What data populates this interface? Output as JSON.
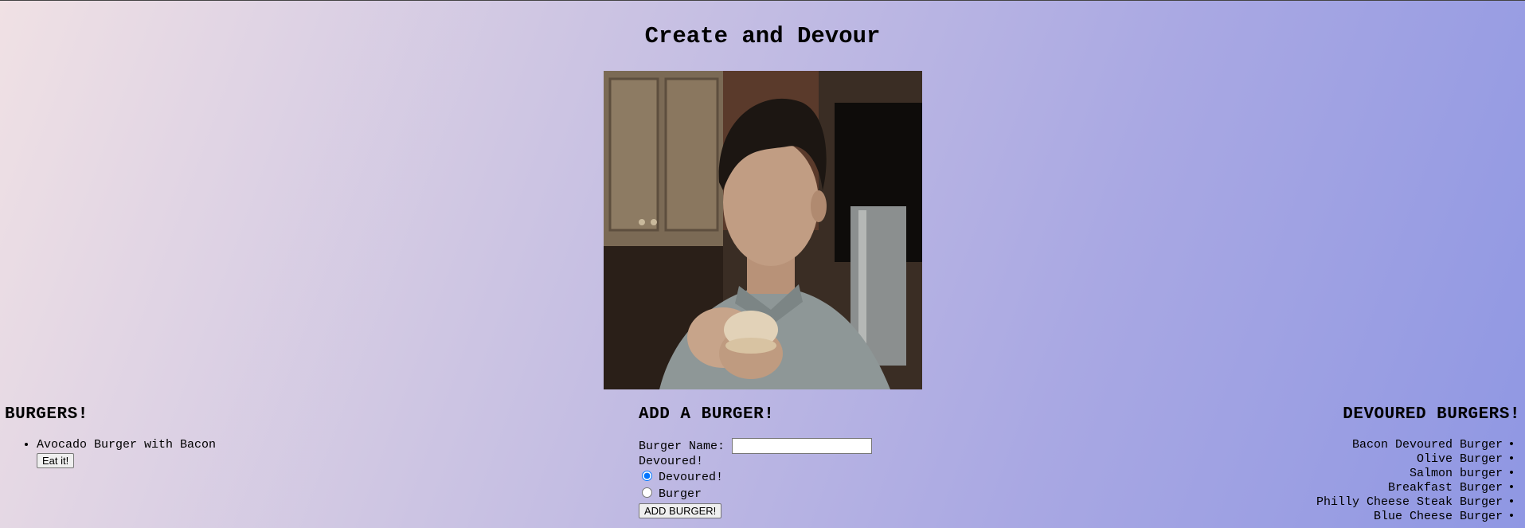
{
  "page": {
    "title": "Create and Devour"
  },
  "burgers": {
    "heading": "BURGERS!",
    "items": [
      {
        "name": "Avocado Burger with Bacon",
        "button_label": "Eat it!"
      }
    ]
  },
  "add_burger": {
    "heading": "ADD A BURGER!",
    "name_label": "Burger Name:",
    "name_value": "",
    "devoured_label": "Devoured!",
    "radio_options": [
      "Devoured!",
      "Burger"
    ],
    "selected_option": "Devoured!",
    "submit_label": "ADD BURGER!"
  },
  "devoured_burgers": {
    "heading": "DEVOURED BURGERS!",
    "items": [
      "Bacon Devoured Burger",
      "Olive Burger",
      "Salmon burger",
      "Breakfast Burger",
      "Philly Cheese Steak Burger",
      "Blue Cheese Burger"
    ]
  },
  "colors": {
    "background_start": "#f0e1e4",
    "background_end": "#8f97e3"
  }
}
